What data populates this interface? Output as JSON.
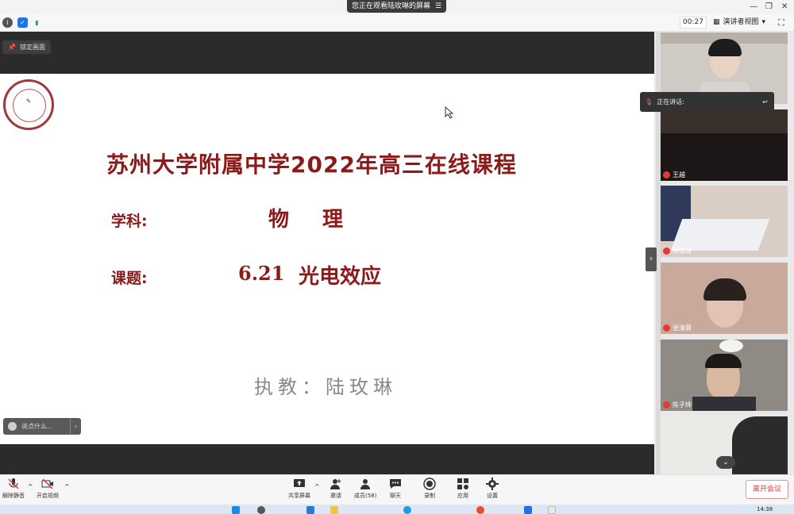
{
  "share_banner": {
    "text": "您正在观看陆玫琳的屏幕",
    "icon": "menu-icon"
  },
  "window_controls": {
    "minimize": "—",
    "restore": "❐",
    "close": "✕"
  },
  "toolbar": {
    "timer": "00:27",
    "view_mode": "演讲者视图"
  },
  "main": {
    "lock_label": "锁定画面",
    "chat_placeholder": "说点什么..."
  },
  "slide": {
    "title": "苏州大学附属中学2022年高三在线课程",
    "subject_label": "学科:",
    "subject_value": "物　理",
    "topic_label": "课题:",
    "topic_number": "6.21",
    "topic_name": "光电效应",
    "teacher": "执教：陆玫琳",
    "accent_color": "#8b1a1a"
  },
  "panel": {
    "speaking_label": "正在讲话:",
    "participants": [
      {
        "name": "",
        "bg": "#cfcac3"
      },
      {
        "name": "王越",
        "bg": "#1c1716"
      },
      {
        "name": "钟炼琦",
        "bg": "#d9cdc6"
      },
      {
        "name": "张清蓉",
        "bg": "#c9a99c"
      },
      {
        "name": "陈子烨",
        "bg": "#8f8a84"
      },
      {
        "name": "",
        "bg": "#eceae6"
      }
    ]
  },
  "bottom": {
    "mute": "解除静音",
    "video": "开启视频",
    "share": "共享屏幕",
    "invite": "邀请",
    "members": "成员(58)",
    "chat": "聊天",
    "record": "录制",
    "apps": "应用",
    "settings": "设置",
    "leave": "离开会议"
  },
  "taskbar": {
    "time": "14:38"
  }
}
